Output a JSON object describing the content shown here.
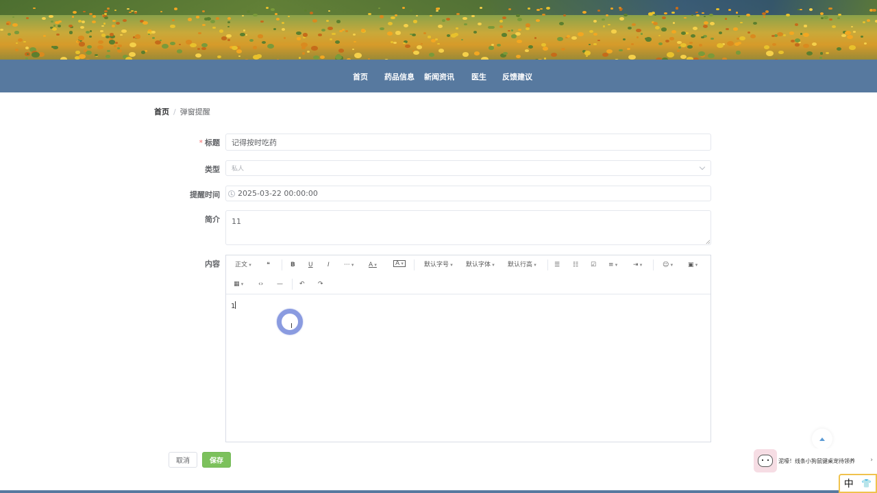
{
  "nav": {
    "items": [
      "首页",
      "药品信息",
      "新闻资讯",
      "医生",
      "反馈建议"
    ]
  },
  "breadcrumb": {
    "home": "首页",
    "current": "弹窗提醒"
  },
  "form": {
    "title_label": "标题",
    "title_required_mark": "*",
    "title_value": "记得按时吃药",
    "type_label": "类型",
    "type_value": "私人",
    "remind_time_label": "提醒时间",
    "remind_time_value": "2025-03-22 00:00:00",
    "intro_label": "简介",
    "intro_value": "11",
    "content_label": "内容",
    "content_value": "1"
  },
  "editor": {
    "toolbar": {
      "paragraph": "正文",
      "quote": "❝",
      "bold": "B",
      "underline": "U",
      "italic": "I",
      "more": "···",
      "font_color": "A",
      "bg_color": "A",
      "font_size": "默认字号",
      "font_family": "默认字体",
      "line_height": "默认行高",
      "bullet_list": "☰",
      "numbered_list": "☷",
      "todo": "☑",
      "align": "≡",
      "indent": "⇥",
      "emoji": "☺",
      "image": "▣",
      "table": "▦",
      "code": "‹›",
      "divider": "—",
      "undo": "↶",
      "redo": "↷"
    }
  },
  "buttons": {
    "cancel": "取消",
    "save": "保存"
  },
  "promo": {
    "text": "泥嚎！线条小狗鼠键桌宠待领养",
    "chevron": "›"
  },
  "ime": {
    "lang": "中",
    "icon": "shirt-icon",
    "icon_glyph": "👕"
  },
  "colors": {
    "nav_bg": "#57799f",
    "save_bg": "#7cc15c",
    "required": "#f56c6c"
  }
}
